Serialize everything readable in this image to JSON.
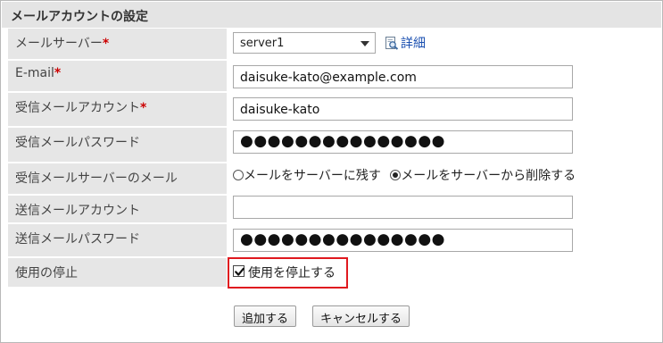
{
  "header": {
    "title": "メールアカウントの設定"
  },
  "rows": {
    "mail_server": {
      "label": "メールサーバー",
      "required": "*",
      "selected": "server1",
      "detail_label": "詳細"
    },
    "email": {
      "label": "E-mail",
      "required": "*",
      "value": "daisuke-kato@example.com"
    },
    "recv_account": {
      "label": "受信メールアカウント",
      "required": "*",
      "value": "daisuke-kato"
    },
    "recv_password": {
      "label": "受信メールパスワード",
      "value": "●●●●●●●●●●●●●●●"
    },
    "server_mail": {
      "label": "受信メールサーバーのメール",
      "options": [
        {
          "label": "メールをサーバーに残す",
          "selected": false
        },
        {
          "label": "メールをサーバーから削除する",
          "selected": true
        }
      ]
    },
    "send_account": {
      "label": "送信メールアカウント",
      "value": ""
    },
    "send_password": {
      "label": "送信メールパスワード",
      "value": "●●●●●●●●●●●●●●●"
    },
    "disable": {
      "label": "使用の停止",
      "checkbox_label": "使用を停止する",
      "checked": true
    }
  },
  "buttons": {
    "add": "追加する",
    "cancel": "キャンセルする"
  },
  "colors": {
    "header_bg": "#e4e4e4",
    "label_bg": "#e6e6e6",
    "required": "#cc0000",
    "highlight_border": "#e0191f",
    "link": "#1a4fb0"
  },
  "icons": {
    "detail": "magnifier-page-icon",
    "select": "chevron-down-icon",
    "check": "checkmark-icon"
  }
}
